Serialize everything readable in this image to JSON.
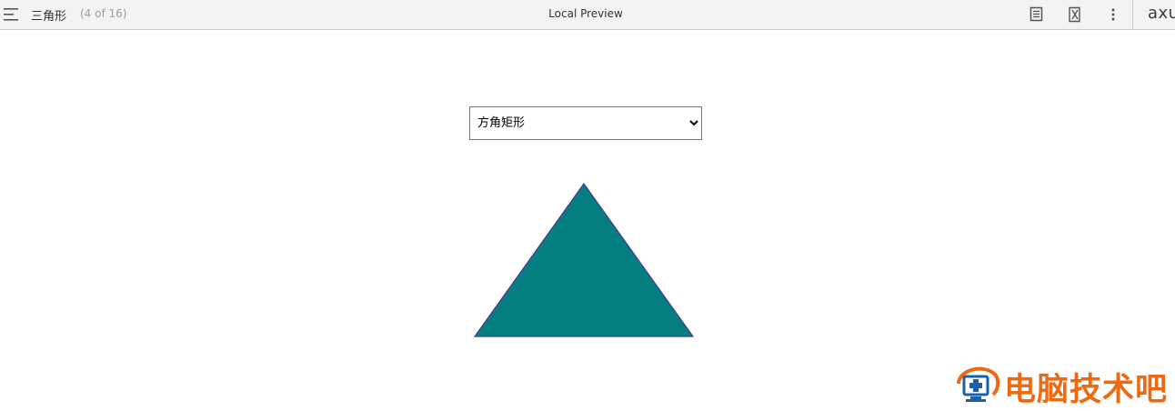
{
  "header": {
    "page_name": "三角形",
    "page_count": "(4 of 16)",
    "title": "Local Preview",
    "brand": "axu"
  },
  "toolbar": {
    "icons": [
      "menu-icon",
      "notes-icon",
      "variables-icon",
      "more-icon"
    ]
  },
  "canvas": {
    "select": {
      "selected": "方角矩形",
      "options": [
        "方角矩形"
      ]
    },
    "shape": {
      "type": "triangle",
      "fill": "#047e80",
      "stroke": "#4b3a8c"
    }
  },
  "watermark": {
    "text": "电脑技术吧",
    "color": "#ee6a12"
  }
}
